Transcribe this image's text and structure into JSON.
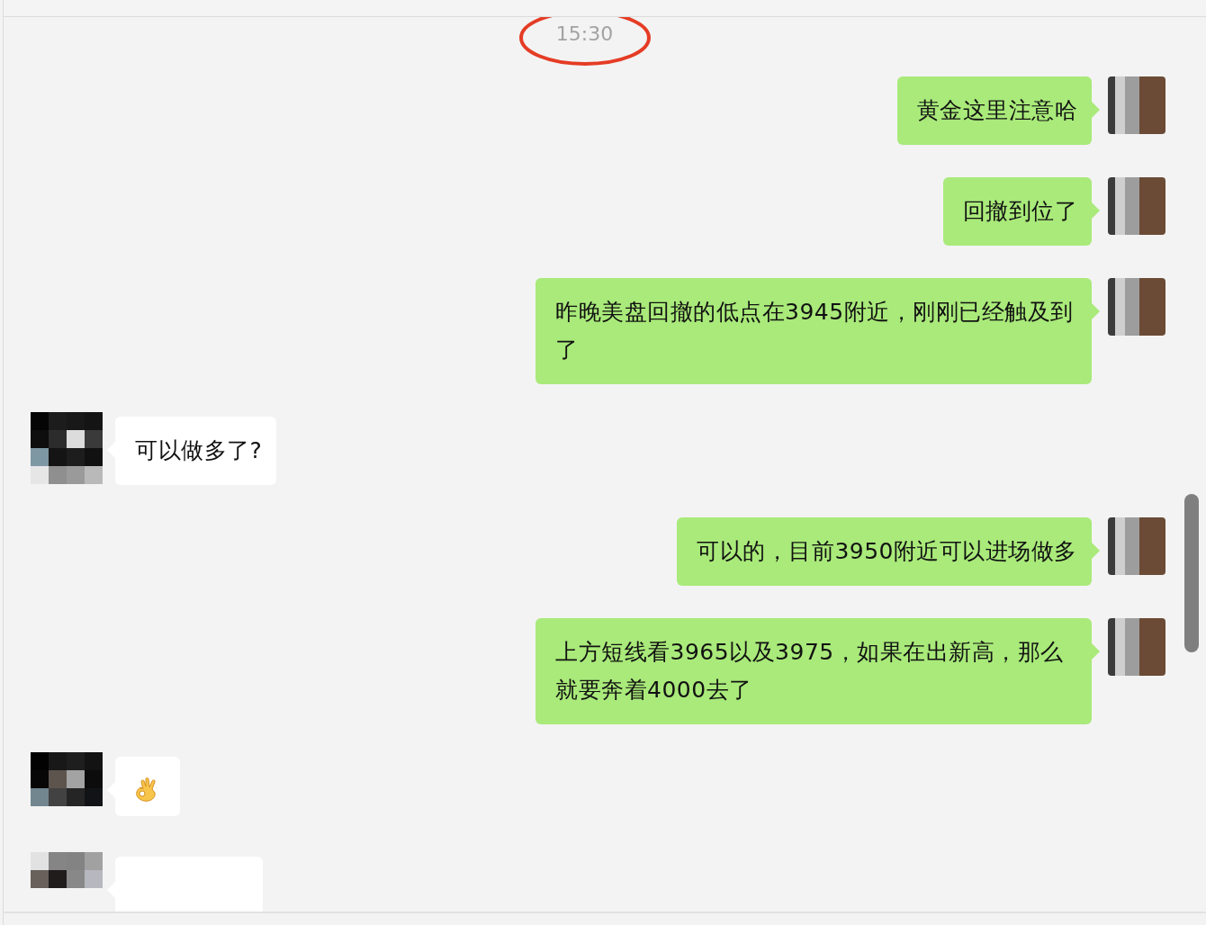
{
  "timestamp": "15:30",
  "messages": [
    {
      "kind": "sent_text",
      "text": "黄金这里注意哈"
    },
    {
      "kind": "sent_text",
      "text": "回撤到位了"
    },
    {
      "kind": "sent_text",
      "text": "昨晚美盘回撤的低点在3945附近，刚刚已经触及到了"
    },
    {
      "kind": "received_text",
      "text": "可以做多了?"
    },
    {
      "kind": "sent_text",
      "text": "可以的，目前3950附近可以进场做多"
    },
    {
      "kind": "sent_text",
      "text": "上方短线看3965以及3975，如果在出新高，那么就要奔着4000去了"
    },
    {
      "kind": "received_sticker"
    },
    {
      "kind": "received_text"
    }
  ]
}
